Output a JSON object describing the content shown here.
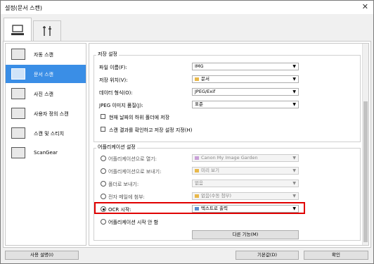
{
  "window": {
    "title": "설정(문서 스캔)",
    "close_icon": "close-icon"
  },
  "tabs": [
    {
      "icon": "scanner-computer-icon"
    },
    {
      "icon": "tools-icon"
    }
  ],
  "sidebar": {
    "items": [
      {
        "label": "자동 스캔",
        "icon": "auto-scan-icon",
        "selected": false
      },
      {
        "label": "문서 스캔",
        "icon": "document-scan-icon",
        "selected": true
      },
      {
        "label": "사진 스캔",
        "icon": "photo-scan-icon",
        "selected": false
      },
      {
        "label": "사용자 정의 스캔",
        "icon": "custom-scan-icon",
        "selected": false
      },
      {
        "label": "스캔 및 스티치",
        "icon": "scan-stitch-icon",
        "selected": false
      },
      {
        "label": "ScanGear",
        "icon": "scangear-icon",
        "selected": false
      }
    ]
  },
  "save_settings": {
    "title": "저장 설정",
    "file_name_label": "파일 이름(F):",
    "file_name_value": "IMG",
    "save_in_label": "저장 위치(V):",
    "save_in_value": "문서",
    "data_format_label": "데이터 형식(O):",
    "data_format_value": "JPEG/Exif",
    "jpeg_quality_label": "JPEG 이미지 품질(J):",
    "jpeg_quality_value": "표준",
    "subfolder_label": "현재 날짜의 하위 폴더에 저장",
    "confirm_label": "스캔 결과를 확인하고 저장 설정 지정(H)"
  },
  "app_settings": {
    "title": "어플리케이션 설정",
    "options": [
      {
        "label": "어플리케이션으로 열기:",
        "value": "Canon My Image Garden",
        "selected": false,
        "disabled": true
      },
      {
        "label": "어플리케이션으로 보내기:",
        "value": "미리 보기",
        "selected": false,
        "disabled": true
      },
      {
        "label": "폴더로 보내기:",
        "value": "없음",
        "selected": false,
        "disabled": true
      },
      {
        "label": "전자 메일에 첨부:",
        "value": "없음(수동 첨부)",
        "selected": false,
        "disabled": true
      },
      {
        "label": "OCR 시작:",
        "value": "텍스트로 출력",
        "selected": true,
        "disabled": false
      },
      {
        "label": "어플리케이션 시작 안 함",
        "selected": false
      }
    ],
    "more_functions_label": "다른 기능(M)"
  },
  "footer": {
    "instructions_label": "사용 설명(I)",
    "defaults_label": "기본값(D)",
    "ok_label": "확인"
  }
}
